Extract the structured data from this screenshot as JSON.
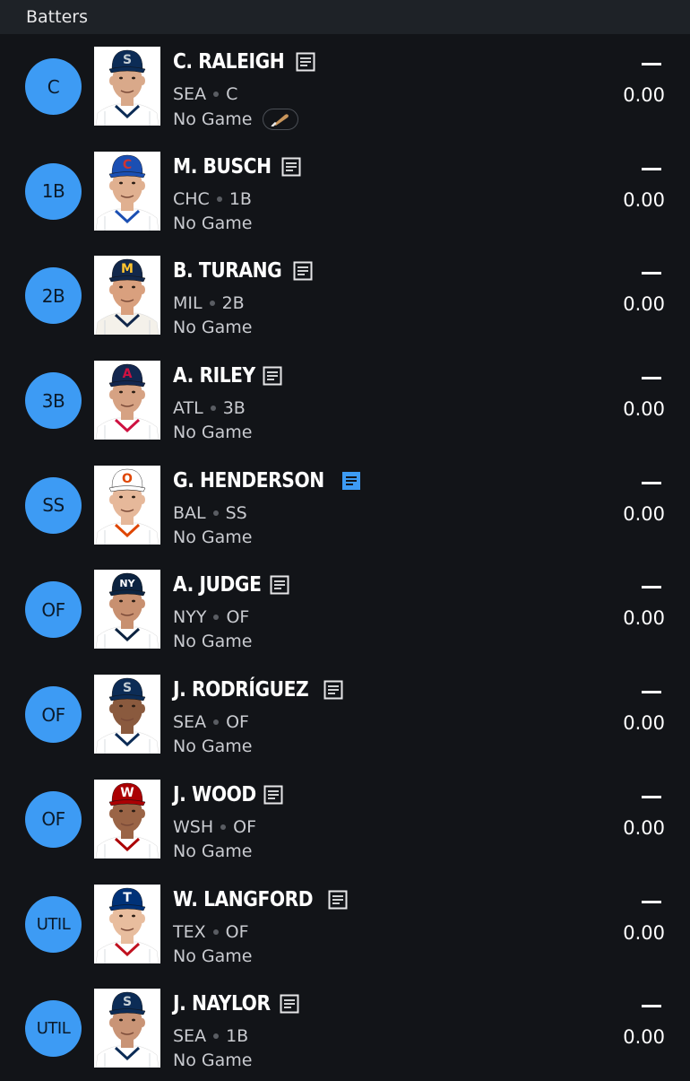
{
  "header": {
    "title": "Batters"
  },
  "players": [
    {
      "position": "C",
      "name": "C. RALEIGH",
      "team": "SEA",
      "pos": "C",
      "game": "No Game",
      "score_dash": "—",
      "score": "0.00",
      "note_active": false,
      "has_bat_badge": true,
      "cap_color": "#0c2c56",
      "cap_logo": "S",
      "logo_color": "#c4ced4",
      "skin": "#d9a98a",
      "jersey": "#ffffff",
      "trim": "#0c2c56"
    },
    {
      "position": "1B",
      "name": "M. BUSCH",
      "team": "CHC",
      "pos": "1B",
      "game": "No Game",
      "score_dash": "—",
      "score": "0.00",
      "note_active": false,
      "has_bat_badge": false,
      "cap_color": "#1b4fb3",
      "cap_logo": "C",
      "logo_color": "#cc3433",
      "skin": "#e0b090",
      "jersey": "#ffffff",
      "trim": "#1b4fb3"
    },
    {
      "position": "2B",
      "name": "B. TURANG",
      "team": "MIL",
      "pos": "2B",
      "game": "No Game",
      "score_dash": "—",
      "score": "0.00",
      "note_active": false,
      "has_bat_badge": false,
      "cap_color": "#12284b",
      "cap_logo": "M",
      "logo_color": "#ffc52f",
      "skin": "#d9a07e",
      "jersey": "#f4f1ea",
      "trim": "#12284b"
    },
    {
      "position": "3B",
      "name": "A. RILEY",
      "team": "ATL",
      "pos": "3B",
      "game": "No Game",
      "score_dash": "—",
      "score": "0.00",
      "note_active": false,
      "has_bat_badge": false,
      "cap_color": "#13274f",
      "cap_logo": "A",
      "logo_color": "#ce1141",
      "skin": "#d6a283",
      "jersey": "#ffffff",
      "trim": "#ce1141"
    },
    {
      "position": "SS",
      "name": "G. HENDERSON",
      "team": "BAL",
      "pos": "SS",
      "game": "No Game",
      "score_dash": "—",
      "score": "0.00",
      "note_active": true,
      "has_bat_badge": false,
      "cap_color": "#ffffff",
      "cap_logo": "O",
      "logo_color": "#df4601",
      "skin": "#e6b89a",
      "jersey": "#ffffff",
      "trim": "#df4601"
    },
    {
      "position": "OF",
      "name": "A. JUDGE",
      "team": "NYY",
      "pos": "OF",
      "game": "No Game",
      "score_dash": "—",
      "score": "0.00",
      "note_active": false,
      "has_bat_badge": false,
      "cap_color": "#0c2340",
      "cap_logo": "NY",
      "logo_color": "#ffffff",
      "skin": "#c89070",
      "jersey": "#ffffff",
      "trim": "#0c2340"
    },
    {
      "position": "OF",
      "name": "J. RODRÍGUEZ",
      "team": "SEA",
      "pos": "OF",
      "game": "No Game",
      "score_dash": "—",
      "score": "0.00",
      "note_active": false,
      "has_bat_badge": false,
      "cap_color": "#0c2c56",
      "cap_logo": "S",
      "logo_color": "#c4ced4",
      "skin": "#8a5a3e",
      "jersey": "#ffffff",
      "trim": "#0c2c56"
    },
    {
      "position": "OF",
      "name": "J. WOOD",
      "team": "WSH",
      "pos": "OF",
      "game": "No Game",
      "score_dash": "—",
      "score": "0.00",
      "note_active": false,
      "has_bat_badge": false,
      "cap_color": "#ab0003",
      "cap_logo": "W",
      "logo_color": "#ffffff",
      "skin": "#9a6446",
      "jersey": "#ffffff",
      "trim": "#ab0003"
    },
    {
      "position": "UTIL",
      "name": "W. LANGFORD",
      "team": "TEX",
      "pos": "OF",
      "game": "No Game",
      "score_dash": "—",
      "score": "0.00",
      "note_active": false,
      "has_bat_badge": false,
      "cap_color": "#003278",
      "cap_logo": "T",
      "logo_color": "#ffffff",
      "skin": "#e8bd9e",
      "jersey": "#ffffff",
      "trim": "#c0111f"
    },
    {
      "position": "UTIL",
      "name": "J. NAYLOR",
      "team": "SEA",
      "pos": "1B",
      "game": "No Game",
      "score_dash": "—",
      "score": "0.00",
      "note_active": false,
      "has_bat_badge": false,
      "cap_color": "#0c2c56",
      "cap_logo": "S",
      "logo_color": "#c4ced4",
      "skin": "#c99476",
      "jersey": "#ffffff",
      "trim": "#0c2c56"
    }
  ],
  "colors": {
    "accent": "#3d9bf4",
    "note_icon_default": "#e6e6e8",
    "background": "#121418",
    "header_bg": "#1e2227"
  }
}
